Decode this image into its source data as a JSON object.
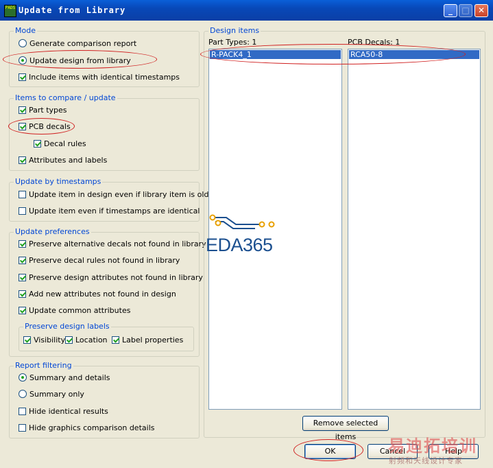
{
  "window": {
    "title": "Update from Library",
    "app_icon_text": "PADS"
  },
  "mode": {
    "legend": "Mode",
    "options": [
      {
        "label": "Generate comparison report",
        "checked": false
      },
      {
        "label": "Update design from library",
        "checked": true
      }
    ],
    "include_identical": {
      "label": "Include items with identical timestamps",
      "checked": true
    }
  },
  "items_compare": {
    "legend": "Items to compare / update",
    "part_types": {
      "label": "Part types",
      "checked": true
    },
    "pcb_decals": {
      "label": "PCB decals",
      "checked": true
    },
    "decal_rules": {
      "label": "Decal rules",
      "checked": true
    },
    "attributes_labels": {
      "label": "Attributes and labels",
      "checked": true
    }
  },
  "timestamps": {
    "legend": "Update by timestamps",
    "older": {
      "label": "Update item in design even if library item is older",
      "checked": false
    },
    "identical": {
      "label": "Update item even if timestamps are identical",
      "checked": false
    }
  },
  "preferences": {
    "legend": "Update preferences",
    "alt_decals": {
      "label": "Preserve alternative decals not found in library",
      "checked": true
    },
    "decal_rules": {
      "label": "Preserve decal rules not found in library",
      "checked": true
    },
    "design_attrs": {
      "label": "Preserve design attributes not found in library",
      "checked": true
    },
    "add_attrs": {
      "label": "Add new attributes not found in design",
      "checked": true
    },
    "common_attrs": {
      "label": "Update common attributes",
      "checked": true
    },
    "labels_group": {
      "legend": "Preserve design labels",
      "visibility": {
        "label": "Visibility",
        "checked": true
      },
      "location": {
        "label": "Location",
        "checked": true
      },
      "label_props": {
        "label": "Label properties",
        "checked": true
      }
    }
  },
  "report": {
    "legend": "Report filtering",
    "summary_details": {
      "label": "Summary and details",
      "checked": true
    },
    "summary_only": {
      "label": "Summary only",
      "checked": false
    },
    "hide_identical": {
      "label": "Hide identical results",
      "checked": false
    },
    "hide_graphics": {
      "label": "Hide graphics comparison details",
      "checked": false
    }
  },
  "design_items": {
    "legend": "Design items",
    "part_types_header": "Part Types: 1",
    "pcb_decals_header": "PCB Decals: 1",
    "part_types": [
      "R-PACK4_1"
    ],
    "pcb_decals": [
      "RCA50-8"
    ],
    "remove_button": "Remove selected items"
  },
  "footer": {
    "ok": "OK",
    "cancel": "Cancel",
    "help": "Help"
  },
  "watermarks": {
    "eda": "EDA365",
    "cn_main": "易迪拓培训",
    "cn_sub": "射频和天线设计专家"
  },
  "colors": {
    "title_bar": "#0848b8",
    "legend_text": "#0046d5",
    "selection": "#316ac5",
    "annotation": "#d02020"
  }
}
